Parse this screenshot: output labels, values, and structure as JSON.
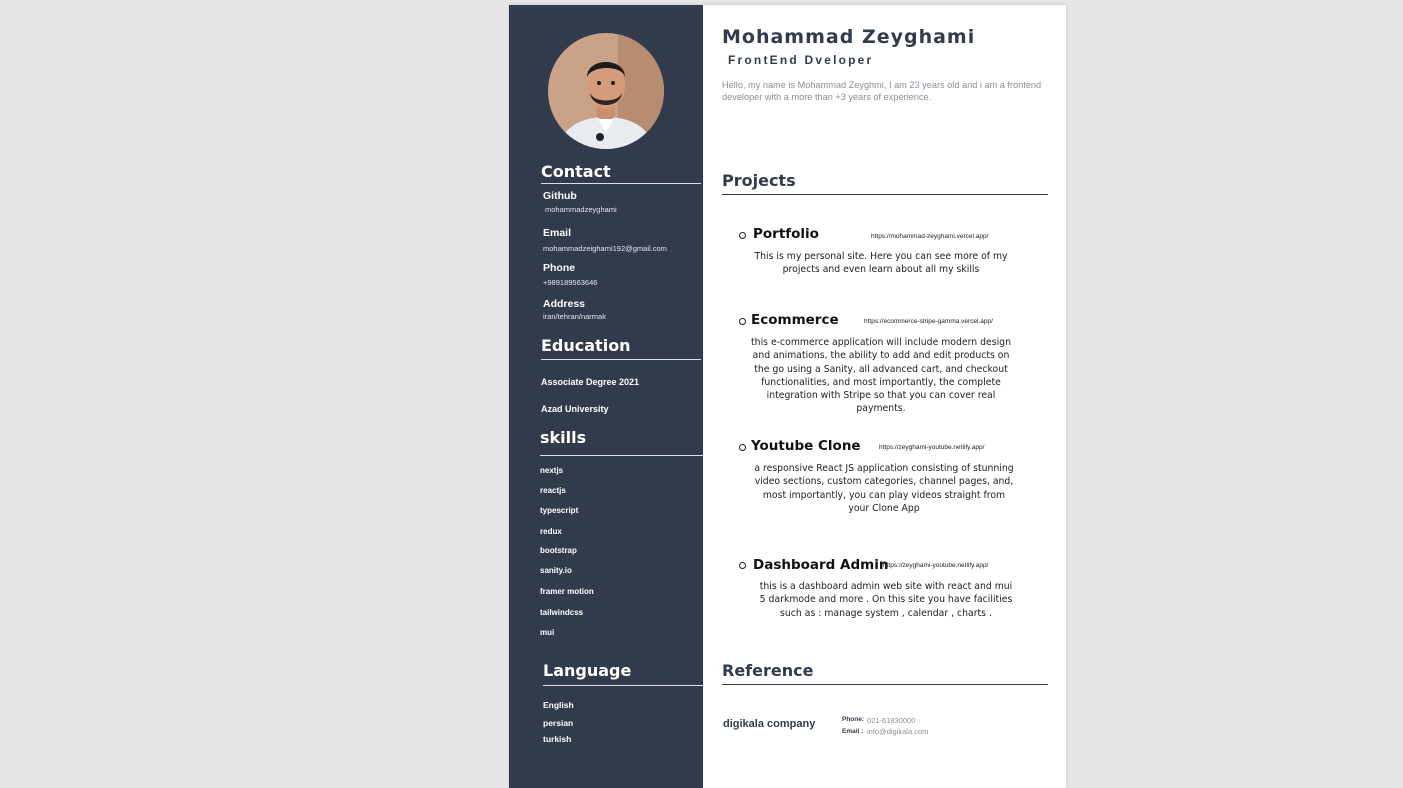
{
  "profile": {
    "name": "Mohammad Zeyghami",
    "role": "FrontEnd Dveloper",
    "bio": "Hello, my name is Mohammad Zeyghmi, I am 23 years old and i am a frontend developer with a more than +3 years of experience."
  },
  "contact": {
    "heading": "Contact",
    "github_label": "Github",
    "github_value": "mohammadzeyghami",
    "email_label": "Email",
    "email_value": "mohammadzeighami192@gmail.com",
    "phone_label": "Phone",
    "phone_value": "+989189563646",
    "address_label": "Address",
    "address_value": "iran/tehran/narmak"
  },
  "education": {
    "heading": "Education",
    "degree": "Associate Degree 2021",
    "school": "Azad University"
  },
  "skills": {
    "heading": "skills",
    "items": [
      "nextjs",
      "reactjs",
      "typescript",
      "redux",
      "bootstrap",
      "sanity.io",
      "framer motion",
      "tailwindcss",
      "mui"
    ]
  },
  "languages": {
    "heading": "Language",
    "items": [
      "English",
      "persian",
      "turkish"
    ]
  },
  "projects": {
    "heading": "Projects",
    "items": [
      {
        "title": "Portfolio",
        "link": "https://mohammad-zeyghami.vercel.app/",
        "description": "This is my personal site. Here you can see more of my projects and even learn about all my skills"
      },
      {
        "title": "Ecommerce",
        "link": "https://ecommerce-stripe-gamma.vercel.app/",
        "description": "this e-commerce application will include modern design and animations, the ability to add and edit products on the go using a Sanity, all advanced cart, and checkout functionalities, and most importantly, the complete integration with Stripe so that you can cover real payments."
      },
      {
        "title": "Youtube Clone",
        "link": "https://zeyghami-youtube.netlify.app/",
        "description": "a responsive React JS application consisting of stunning video sections, custom categories, channel pages, and, most importantly, you can play videos straight from your Clone App"
      },
      {
        "title": "Dashboard Admin",
        "link": "https://zeyghami-youtube.netlify.app/",
        "description": "this is a dashboard admin web site with react and mui 5 darkmode and more . On this site you have facilities such as :  manage system , calendar , charts ."
      }
    ]
  },
  "reference": {
    "heading": "Reference",
    "company": "digikala company",
    "phone_label": "Phone:",
    "phone_value": "021-61930000",
    "email_label": "Email :",
    "email_value": "info@digikala.com"
  },
  "colors": {
    "sidebar": "#323b4c",
    "accent_text": "#323b4c",
    "muted_text": "#8a8f98",
    "background": "#e6e6e6"
  }
}
